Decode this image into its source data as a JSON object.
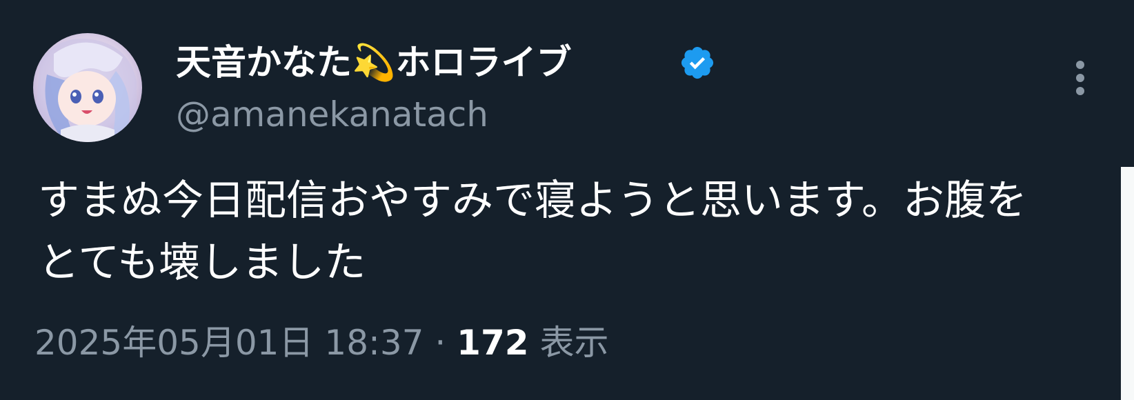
{
  "tweet": {
    "display_name": "天音かなた💫ホロライブ",
    "handle": "@amanekanatach",
    "text": "すまぬ今日配信おやすみで寝ようと思います。お腹をとても壊しました",
    "timestamp": "2025年05月01日 18:37",
    "separator": " · ",
    "views_count": "172",
    "views_label": " 表示"
  },
  "icons": {
    "avatar": "profile-avatar",
    "verified": "verified-badge-icon",
    "more": "more-vertical-icon"
  },
  "colors": {
    "background": "#15202b",
    "primary_text": "#ffffff",
    "secondary_text": "#8b98a5",
    "verified_blue": "#1d9bf0",
    "scrollbar": "#f7f9f9"
  }
}
